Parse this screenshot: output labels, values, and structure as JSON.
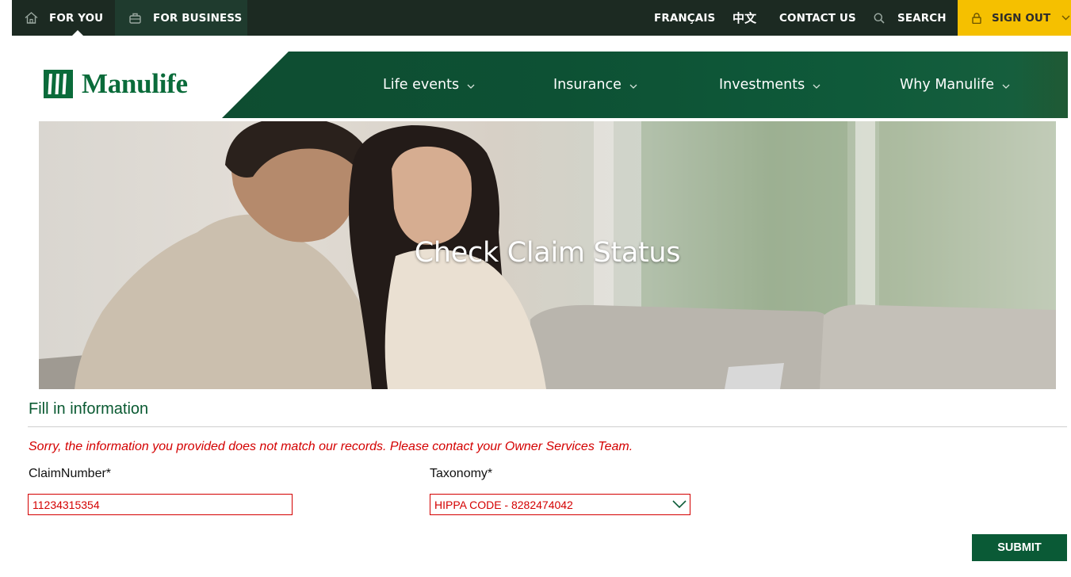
{
  "topbar": {
    "for_you": "FOR YOU",
    "for_business": "FOR BUSINESS",
    "french": "FRANÇAIS",
    "chinese": "中文",
    "contact": "CONTACT US",
    "search": "SEARCH",
    "sign_out": "SIGN OUT"
  },
  "brand": {
    "name": "Manulife",
    "color": "#0a6b3a"
  },
  "nav": {
    "items": [
      {
        "label": "Life events"
      },
      {
        "label": "Insurance"
      },
      {
        "label": "Investments"
      },
      {
        "label": "Why Manulife"
      }
    ]
  },
  "hero": {
    "title": "Check Claim Status"
  },
  "form": {
    "section_title": "Fill in information",
    "error": "Sorry, the information you provided does not match our records. Please contact your Owner Services Team.",
    "claim_label": "ClaimNumber*",
    "claim_value": "11234315354",
    "taxonomy_label": "Taxonomy*",
    "taxonomy_value": "HIPPA CODE - 8282474042",
    "submit": "SUBMIT"
  },
  "colors": {
    "topbar": "#1c2a22",
    "sign_out": "#f5c000",
    "nav": "#0e4d31",
    "error": "#d40000",
    "submit": "#0a5a36"
  },
  "icons": {
    "for_you": "home-icon",
    "for_business": "briefcase-icon",
    "search": "search-icon",
    "sign_out": "lock-icon"
  }
}
